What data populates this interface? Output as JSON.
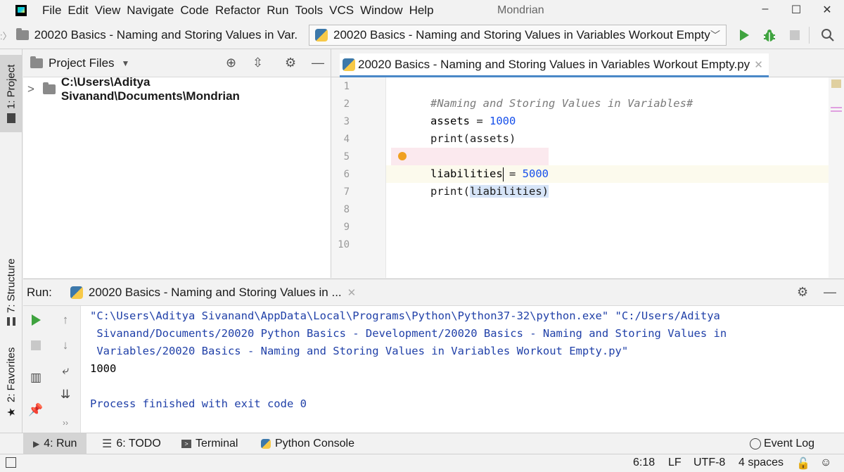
{
  "menu": {
    "items": [
      "File",
      "Edit",
      "View",
      "Navigate",
      "Code",
      "Refactor",
      "Run",
      "Tools",
      "VCS",
      "Window",
      "Help"
    ]
  },
  "window": {
    "title": "Mondrian"
  },
  "navbar": {
    "breadcrumb": "20020 Basics - Naming and Storing Values in Var.",
    "run_config": "20020 Basics - Naming and Storing Values in Variables Workout Empty"
  },
  "left_stripe": {
    "project_tab": "1: Project",
    "structure_tab": "7: Structure",
    "favorites_tab": "2: Favorites"
  },
  "project_panel": {
    "title": "Project Files",
    "root_path": "C:\\Users\\Aditya Sivanand\\Documents\\Mondrian"
  },
  "editor": {
    "tab_label": "20020 Basics - Naming and Storing Values in Variables Workout Empty.py",
    "line_numbers": [
      "1",
      "2",
      "3",
      "4",
      "5",
      "6",
      "7",
      "8",
      "9",
      "10"
    ],
    "lines": {
      "l1": "#Naming and Storing Values in Variables#",
      "l2_id": "assets",
      "l2_op": " = ",
      "l2_num": "1000",
      "l3": "print(assets)",
      "l5_id": "liabilities",
      "l5_op": " = ",
      "l5_num": "5000",
      "l6_fn": "print(",
      "l6_arg": "liabilities",
      "l6_end": ")"
    },
    "cursor_position": "6:18"
  },
  "run_panel": {
    "label": "Run:",
    "tab_label": "20020 Basics - Naming and Storing Values in ...",
    "console": [
      "\"C:\\Users\\Aditya Sivanand\\AppData\\Local\\Programs\\Python\\Python37-32\\python.exe\" \"C:/Users/Aditya",
      " Sivanand/Documents/20020 Python Basics - Development/20020 Basics - Naming and Storing Values in",
      " Variables/20020 Basics - Naming and Storing Values in Variables Workout Empty.py\"",
      "1000",
      "",
      "Process finished with exit code 0"
    ]
  },
  "bottom_bar": {
    "run": "4: Run",
    "todo": "6: TODO",
    "terminal": "Terminal",
    "python_console": "Python Console",
    "event_log": "Event Log"
  },
  "status_bar": {
    "position": "6:18",
    "line_sep": "LF",
    "encoding": "UTF-8",
    "indent": "4 spaces"
  },
  "colors": {
    "accent": "#4a88c7",
    "run_green": "#3fa33f",
    "number_blue": "#1750eb",
    "console_path": "#2040a8"
  }
}
